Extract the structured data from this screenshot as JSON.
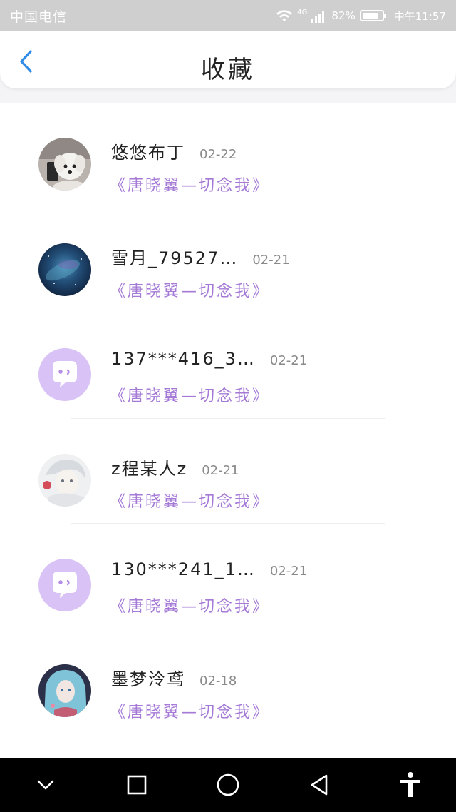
{
  "status_bar": {
    "carrier": "中国电信",
    "network": "4G",
    "battery_percent": "82%",
    "time": "中午11:57"
  },
  "header": {
    "title": "收藏",
    "back_icon": "chevron-left-icon",
    "accent_color": "#2f8be6"
  },
  "favorites": [
    {
      "name": "悠悠布丁",
      "date": "02-22",
      "quote": "《唐晓翼—切念我》",
      "avatar": "puppy-photo"
    },
    {
      "name": "雪月_79527…",
      "date": "02-21",
      "quote": "《唐晓翼—切念我》",
      "avatar": "galaxy-photo"
    },
    {
      "name": "137***416_3…",
      "date": "02-21",
      "quote": "《唐晓翼—切念我》",
      "avatar": "default-chat-avatar"
    },
    {
      "name": "z程某人z",
      "date": "02-21",
      "quote": "《唐晓翼—切念我》",
      "avatar": "anime-white-hair"
    },
    {
      "name": "130***241_1…",
      "date": "02-21",
      "quote": "《唐晓翼—切念我》",
      "avatar": "default-chat-avatar"
    },
    {
      "name": "墨梦泠鸢",
      "date": "02-18",
      "quote": "《唐晓翼—切念我》",
      "avatar": "anime-blue-hair"
    }
  ],
  "colors": {
    "quote": "#a57ad6",
    "default_avatar_bg": "#d9c2f5"
  },
  "system_nav": [
    "collapse-chevron-icon",
    "recent-apps-square-icon",
    "home-circle-icon",
    "back-triangle-icon",
    "accessibility-icon"
  ]
}
